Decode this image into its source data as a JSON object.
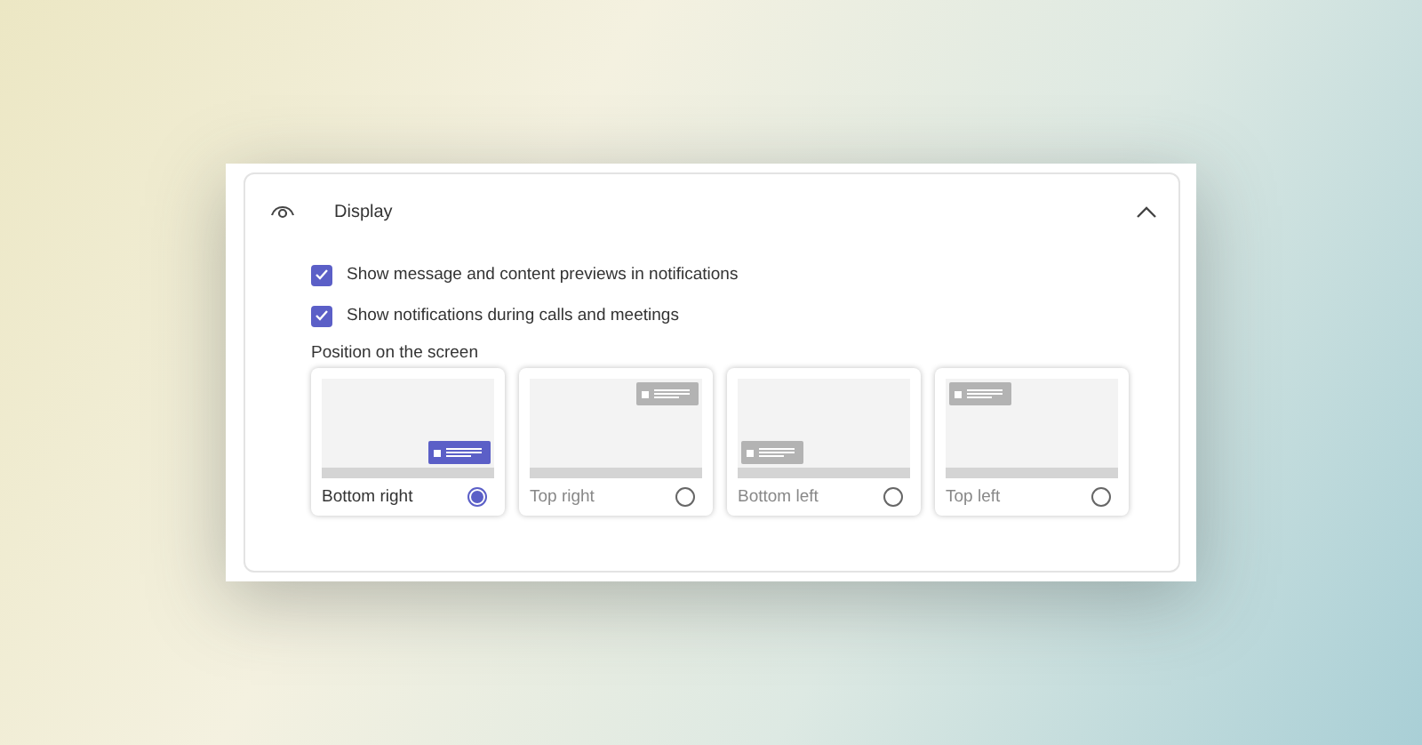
{
  "section": {
    "title": "Display",
    "expanded": true
  },
  "checkboxes": [
    {
      "label": "Show message and content previews in notifications",
      "checked": true
    },
    {
      "label": "Show notifications during calls and meetings",
      "checked": true
    }
  ],
  "position": {
    "label": "Position on the screen",
    "options": [
      {
        "label": "Bottom right",
        "kind": "bottom-right",
        "selected": true
      },
      {
        "label": "Top right",
        "kind": "top-right",
        "selected": false
      },
      {
        "label": "Bottom left",
        "kind": "bottom-left",
        "selected": false
      },
      {
        "label": "Top left",
        "kind": "top-left",
        "selected": false
      }
    ]
  }
}
